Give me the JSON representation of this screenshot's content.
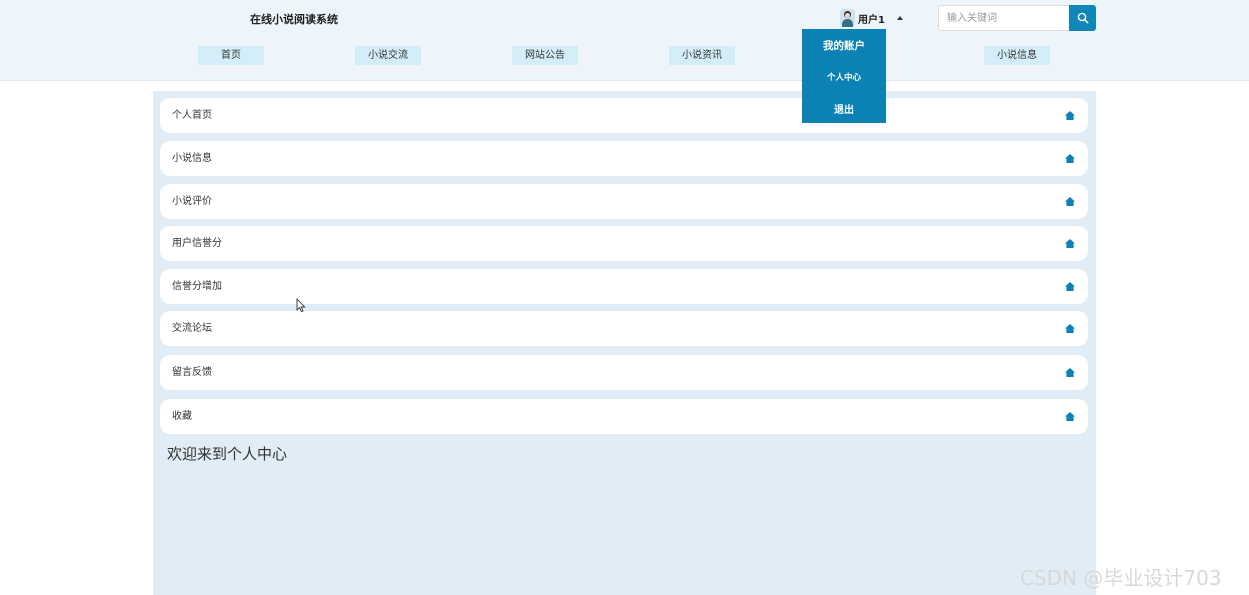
{
  "header": {
    "title": "在线小说阅读系统",
    "user_name": "用户1",
    "search_placeholder": "输入关键词"
  },
  "nav": {
    "items": [
      {
        "label": "首页"
      },
      {
        "label": "小说交流"
      },
      {
        "label": "网站公告"
      },
      {
        "label": "小说资讯"
      },
      {
        "label": "小说信息"
      }
    ]
  },
  "dropdown": {
    "items": [
      {
        "label": "我的账户"
      },
      {
        "label": "个人中心"
      },
      {
        "label": "退出"
      }
    ]
  },
  "sidebar": {
    "items": [
      {
        "label": "个人首页"
      },
      {
        "label": "小说信息"
      },
      {
        "label": "小说评价"
      },
      {
        "label": "用户信誉分"
      },
      {
        "label": "信誉分增加"
      },
      {
        "label": "交流论坛"
      },
      {
        "label": "留言反馈"
      },
      {
        "label": "收藏"
      }
    ]
  },
  "main": {
    "welcome": "欢迎来到个人中心"
  },
  "watermark": "CSDN @毕业设计703",
  "colors": {
    "accent": "#0b82b3",
    "header_bg": "#edf5fb",
    "panel_bg": "#e0edf6",
    "nav_item_bg": "#d4eef9"
  }
}
